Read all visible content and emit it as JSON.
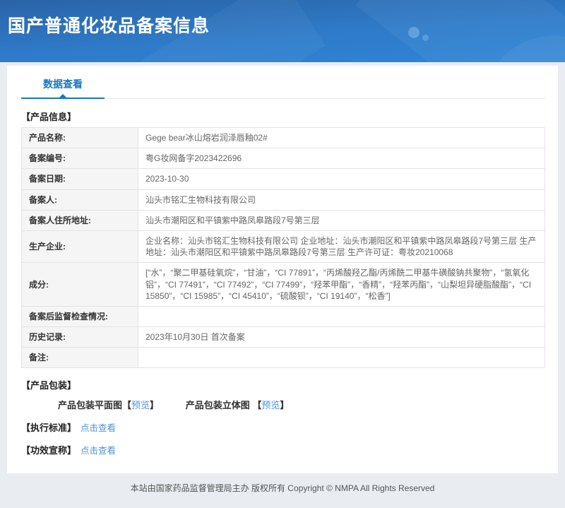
{
  "header": {
    "title": "国产普通化妆品备案信息"
  },
  "tabs": {
    "data_view": "数据查看"
  },
  "colors": {
    "accent_blue": "#1778c2",
    "link_blue": "#4f94d5",
    "header_gradient_top": "#2b63a6",
    "header_gradient_bottom": "#2f85d6",
    "label_cell_bg": "#f5f5f5"
  },
  "product_info": {
    "section_title": "【产品信息】",
    "rows": [
      {
        "label": "产品名称:",
        "value": "Gege bear冰山熔岩润泽唇釉02#"
      },
      {
        "label": "备案编号:",
        "value": "粤G妆网备字2023422696"
      },
      {
        "label": "备案日期:",
        "value": "2023-10-30"
      },
      {
        "label": "备案人:",
        "value": "汕头市铭汇生物科技有限公司"
      },
      {
        "label": "备案人住所地址:",
        "value": "汕头市潮阳区和平镇紫中路凤皋路段7号第三层"
      },
      {
        "label": "生产企业:",
        "value": "企业名称：汕头市铭汇生物科技有限公司 企业地址：汕头市潮阳区和平镇紫中路凤皋路段7号第三层 生产地址：汕头市潮阳区和平镇紫中路凤皋路段7号第三层 生产许可证：粤妆20210068"
      },
      {
        "label": "成分:",
        "value": "[“水”，“聚二甲基硅氧烷”，“甘油”，“CI 77891”，“丙烯酸羟乙酯/丙烯酰二甲基牛磺酸钠共聚物”，“氢氧化铝”，“CI 77491”，“CI 77492”，“CI 77499”，“羟苯甲酯”，“香精”，“羟苯丙酯”，“山梨坦异硬脂酸酯”，“CI 15850”，“CI 15985”，“CI 45410”，“硫酸钡”，“CI 19140”，“松香”]"
      },
      {
        "label": "备案后监督检查情况:",
        "value": ""
      },
      {
        "label": "历史记录:",
        "value": "2023年10月30日 首次备案"
      },
      {
        "label": "备注:",
        "value": ""
      }
    ]
  },
  "packaging": {
    "section_title": "【产品包装】",
    "items": [
      {
        "label": "产品包装平面图",
        "bracket_open": "【",
        "link": "预览",
        "bracket_close": "】"
      },
      {
        "label": "产品包装立体图 ",
        "bracket_open": "【",
        "link": "预览",
        "bracket_close": "】"
      }
    ]
  },
  "standards": {
    "label": "【执行标准】",
    "link": "点击查看"
  },
  "efficacy": {
    "label": "【功效宣称】",
    "link": "点击查看"
  },
  "footer": {
    "text": "本站由国家药品监督管理局主办 版权所有 Copyright © NMPA All Rights Reserved"
  }
}
